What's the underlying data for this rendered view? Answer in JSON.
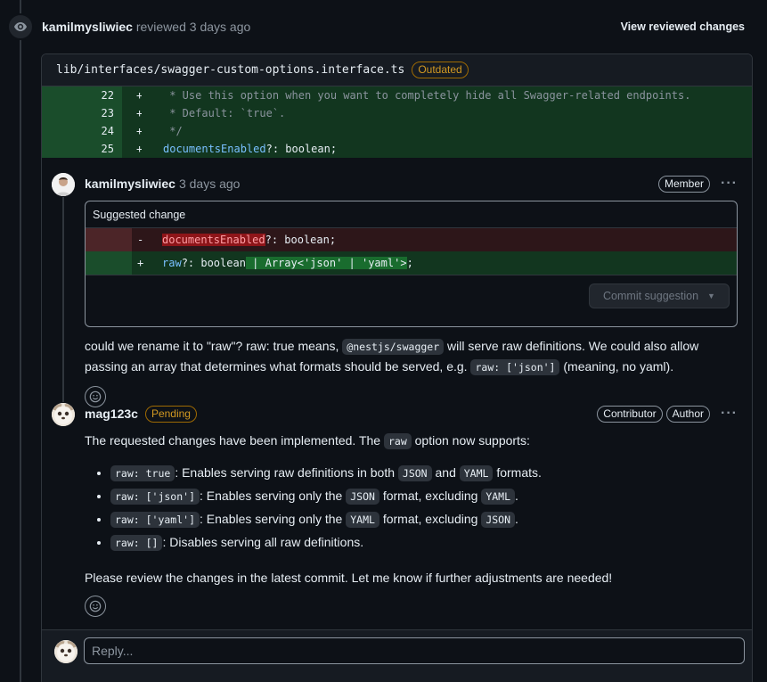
{
  "review": {
    "author": "kamilmysliwiec",
    "action": "reviewed",
    "time": "3 days ago",
    "view_changes_label": "View reviewed changes"
  },
  "file": {
    "path": "lib/interfaces/swagger-custom-options.interface.ts",
    "badge": "Outdated",
    "lines": [
      {
        "num": "22",
        "sign": "+",
        "code": " * Use this option when you want to completely hide all Swagger-related endpoints."
      },
      {
        "num": "23",
        "sign": "+",
        "code": " * Default: `true`."
      },
      {
        "num": "24",
        "sign": "+",
        "code": " */"
      },
      {
        "num": "25",
        "sign": "+",
        "prop": "documentsEnabled",
        "rest": "?: boolean;"
      }
    ]
  },
  "comment1": {
    "author": "kamilmysliwiec",
    "time": "3 days ago",
    "role": "Member",
    "suggestion": {
      "header": "Suggested change",
      "removed": {
        "sign": "-",
        "prop": "documentsEnabled",
        "rest": "?: boolean;"
      },
      "added": {
        "sign": "+",
        "prop": "raw",
        "mid": "?: boolean",
        "hl": " | Array<'json' | 'yaml'>",
        "end": ";"
      },
      "commit_label": "Commit suggestion"
    },
    "text": {
      "p1": "could we rename it to \"raw\"? raw: true means,",
      "code1": "@nestjs/swagger",
      "p2": "will serve raw definitions. We could also allow passing an array that determines what formats should be served, e.g.",
      "code2": "raw: ['json']",
      "p3": "(meaning, no yaml)."
    }
  },
  "comment2": {
    "author": "mag123c",
    "status": "Pending",
    "roles": [
      "Contributor",
      "Author"
    ],
    "intro": "The requested changes have been implemented. The",
    "intro_code": "raw",
    "intro_end": "option now supports:",
    "items": [
      {
        "code": "raw: true",
        "text": ": Enables serving raw definitions in both",
        "c1": "JSON",
        "mid": "and",
        "c2": "YAML",
        "end": "formats."
      },
      {
        "code": "raw: ['json']",
        "text": ": Enables serving only the",
        "c1": "JSON",
        "mid": "format, excluding",
        "c2": "YAML",
        "end": "."
      },
      {
        "code": "raw: ['yaml']",
        "text": ": Enables serving only the",
        "c1": "YAML",
        "mid": "format, excluding",
        "c2": "JSON",
        "end": "."
      },
      {
        "code": "raw: []",
        "text": ": Disables serving all raw definitions.",
        "c1": "",
        "mid": "",
        "c2": "",
        "end": ""
      }
    ],
    "closing": "Please review the changes in the latest commit. Let me know if further adjustments are needed!"
  },
  "reply": {
    "placeholder": "Reply..."
  },
  "colors": {
    "bg": "#0d1117",
    "added_bg": "#12361f",
    "removed_bg": "#2d1619",
    "pending": "#d29922"
  }
}
